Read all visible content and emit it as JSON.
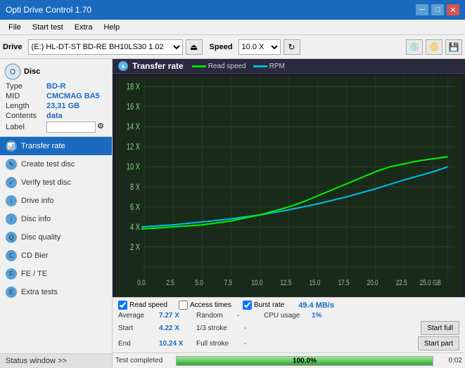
{
  "titlebar": {
    "title": "Opti Drive Control 1.70",
    "minimize": "─",
    "maximize": "□",
    "close": "✕"
  },
  "menubar": {
    "items": [
      "File",
      "Start test",
      "Extra",
      "Help"
    ]
  },
  "toolbar": {
    "drive_label": "Drive",
    "drive_value": "(E:)  HL-DT-ST BD-RE  BH10LS30  1.02",
    "speed_label": "Speed",
    "speed_value": "10.0 X"
  },
  "disc": {
    "header": "Disc",
    "type_label": "Type",
    "type_value": "BD-R",
    "mid_label": "MID",
    "mid_value": "CMCMAG BA5",
    "length_label": "Length",
    "length_value": "23,31 GB",
    "contents_label": "Contents",
    "contents_value": "data",
    "label_label": "Label"
  },
  "nav": {
    "items": [
      {
        "id": "transfer-rate",
        "label": "Transfer rate",
        "active": true
      },
      {
        "id": "create-test-disc",
        "label": "Create test disc",
        "active": false
      },
      {
        "id": "verify-test-disc",
        "label": "Verify test disc",
        "active": false
      },
      {
        "id": "drive-info",
        "label": "Drive info",
        "active": false
      },
      {
        "id": "disc-info",
        "label": "Disc info",
        "active": false
      },
      {
        "id": "disc-quality",
        "label": "Disc quality",
        "active": false
      },
      {
        "id": "cd-bier",
        "label": "CD Bier",
        "active": false
      },
      {
        "id": "fe-te",
        "label": "FE / TE",
        "active": false
      },
      {
        "id": "extra-tests",
        "label": "Extra tests",
        "active": false
      }
    ],
    "status_btn": "Status window >>"
  },
  "chart": {
    "title": "Transfer rate",
    "legend_read": "Read speed",
    "legend_rpm": "RPM",
    "read_color": "#00dd00",
    "rpm_color": "#00bbdd",
    "y_labels": [
      "18 X",
      "16 X",
      "14 X",
      "12 X",
      "10 X",
      "8 X",
      "6 X",
      "4 X",
      "2 X"
    ],
    "x_labels": [
      "0.0",
      "2.5",
      "5.0",
      "7.5",
      "10.0",
      "12.5",
      "15.0",
      "17.5",
      "20.0",
      "22.5",
      "25.0 GB"
    ]
  },
  "checkboxes": {
    "read_speed": {
      "label": "Read speed",
      "checked": true
    },
    "access_times": {
      "label": "Access times",
      "checked": false
    },
    "burst_rate": {
      "label": "Burst rate",
      "checked": true
    },
    "burst_value": "49.4 MB/s"
  },
  "stats": {
    "average_label": "Average",
    "average_value": "7.27 X",
    "random_label": "Random",
    "random_value": "-",
    "cpu_label": "CPU usage",
    "cpu_value": "1%",
    "start_label": "Start",
    "start_value": "4.22 X",
    "stroke13_label": "1/3 stroke",
    "stroke13_value": "-",
    "start_full_btn": "Start full",
    "end_label": "End",
    "end_value": "10.24 X",
    "full_stroke_label": "Full stroke",
    "full_stroke_value": "-",
    "start_part_btn": "Start part"
  },
  "progress": {
    "status": "Test completed",
    "percent": "100.0%",
    "time": "0:02"
  }
}
